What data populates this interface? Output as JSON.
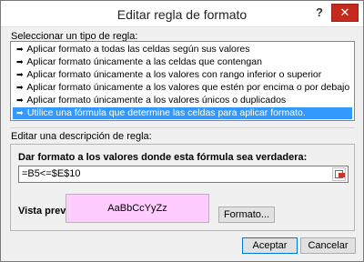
{
  "window": {
    "title": "Editar regla de formato",
    "help_label": "?",
    "close_label": "✕"
  },
  "rule_type": {
    "label": "Seleccionar un tipo de regla:",
    "items": [
      "Aplicar formato a todas las celdas según sus valores",
      "Aplicar formato únicamente a las celdas que contengan",
      "Aplicar formato únicamente a los valores con rango inferior o superior",
      "Aplicar formato únicamente a los valores que estén por encima o por debajo del promedio",
      "Aplicar formato únicamente a los valores únicos o duplicados",
      "Utilice una fórmula que determine las celdas para aplicar formato."
    ],
    "selected_index": 5,
    "arrow_glyph": "➡"
  },
  "description": {
    "label": "Editar una descripción de regla:",
    "formula_label": "Dar formato a los valores donde esta fórmula sea verdadera:",
    "formula_value": "=B5<=$E$10",
    "preview_label": "Vista previa:",
    "preview_text": "AaBbCcYyZz",
    "preview_color": "#ffccff",
    "format_button_label": "Formato..."
  },
  "footer": {
    "ok_label": "Aceptar",
    "cancel_label": "Cancelar"
  }
}
